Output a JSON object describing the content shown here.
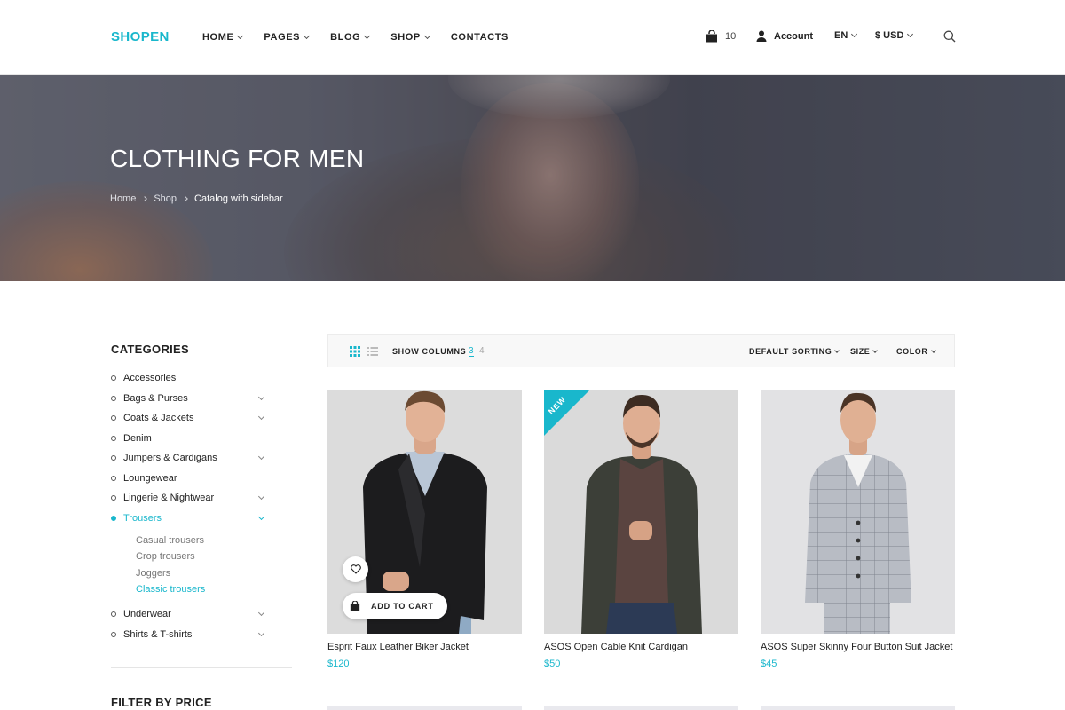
{
  "brand": {
    "name": "SHOPEN",
    "accent": "#19b7cc"
  },
  "nav": {
    "items": [
      {
        "label": "HOME",
        "has_dropdown": true
      },
      {
        "label": "PAGES",
        "has_dropdown": true
      },
      {
        "label": "BLOG",
        "has_dropdown": true
      },
      {
        "label": "SHOP",
        "has_dropdown": true
      },
      {
        "label": "CONTACTS",
        "has_dropdown": false
      }
    ]
  },
  "header": {
    "cart_count": "10",
    "account_label": "Account",
    "language": "EN",
    "currency": "$ USD",
    "icons": {
      "cart": "shopping-bag-icon",
      "account": "user-icon",
      "search": "search-icon"
    }
  },
  "hero": {
    "title": "CLOTHING FOR MEN",
    "breadcrumb": [
      "Home",
      "Shop",
      "Catalog with sidebar"
    ]
  },
  "sidebar": {
    "title": "CATEGORIES",
    "categories": [
      {
        "label": "Accessories",
        "has_children": false
      },
      {
        "label": "Bags & Purses",
        "has_children": true
      },
      {
        "label": "Coats & Jackets",
        "has_children": true
      },
      {
        "label": "Denim",
        "has_children": false
      },
      {
        "label": "Jumpers & Cardigans",
        "has_children": true
      },
      {
        "label": "Loungewear",
        "has_children": false
      },
      {
        "label": "Lingerie & Nightwear",
        "has_children": true
      },
      {
        "label": "Trousers",
        "has_children": true,
        "active": true
      },
      {
        "label": "Underwear",
        "has_children": true
      },
      {
        "label": "Shirts & T-shirts",
        "has_children": true
      }
    ],
    "subcategories": [
      {
        "label": "Casual trousers"
      },
      {
        "label": "Crop trousers"
      },
      {
        "label": "Joggers"
      },
      {
        "label": "Classic trousers",
        "active": true
      }
    ],
    "filter_title": "FILTER BY PRICE"
  },
  "toolbar": {
    "show_columns_label": "SHOW COLUMNS",
    "columns": [
      "3",
      "4"
    ],
    "selected_columns": "3",
    "sort_label": "DEFAULT SORTING",
    "size_label": "SIZE",
    "color_label": "COLOR"
  },
  "products": [
    {
      "name": "Esprit Faux Leather Biker Jacket",
      "price": "$120",
      "badge": "",
      "add_to_cart": "ADD TO CART"
    },
    {
      "name": "ASOS Open Cable Knit Cardigan",
      "price": "$50",
      "badge": "NEW"
    },
    {
      "name": "ASOS Super Skinny Four Button Suit Jacket",
      "price": "$45",
      "badge": ""
    }
  ]
}
